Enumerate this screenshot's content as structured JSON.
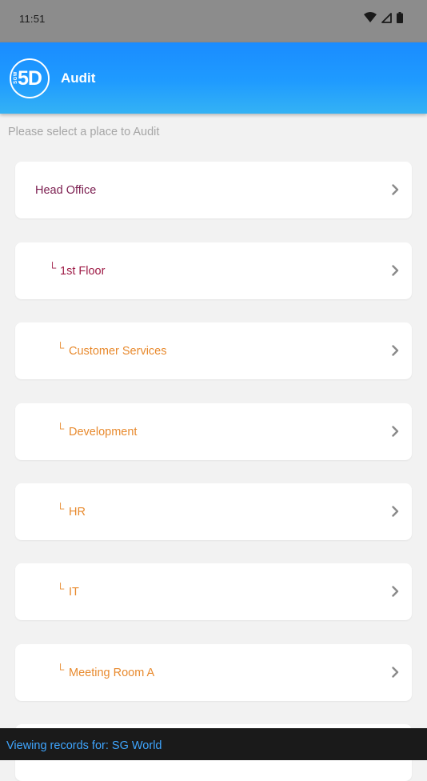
{
  "status_bar": {
    "time": "11:51",
    "icons": [
      "wifi-icon",
      "cellular-signal-icon",
      "battery-icon"
    ]
  },
  "app_bar": {
    "logo_text": "5D",
    "logo_small_text": "SGW",
    "title": "Audit"
  },
  "prompt": "Please select a place to Audit",
  "prefix_glyph": "└",
  "items": [
    {
      "label": "Head Office",
      "level": 0
    },
    {
      "label": "1st Floor",
      "level": 1
    },
    {
      "label": "Customer Services",
      "level": 2
    },
    {
      "label": "Development",
      "level": 2
    },
    {
      "label": "HR",
      "level": 2
    },
    {
      "label": "IT",
      "level": 2
    },
    {
      "label": "Meeting Room A",
      "level": 2
    }
  ],
  "colors": {
    "app_bar": "#1f9bff",
    "level_0_text": "#7b1d4f",
    "level_1_text": "#9e1a45",
    "level_2_text": "#e88a2e",
    "footer_text": "#3fa6ff",
    "chevron": "#8a8a8a"
  },
  "footer": {
    "text": "Viewing records for: SG World"
  }
}
